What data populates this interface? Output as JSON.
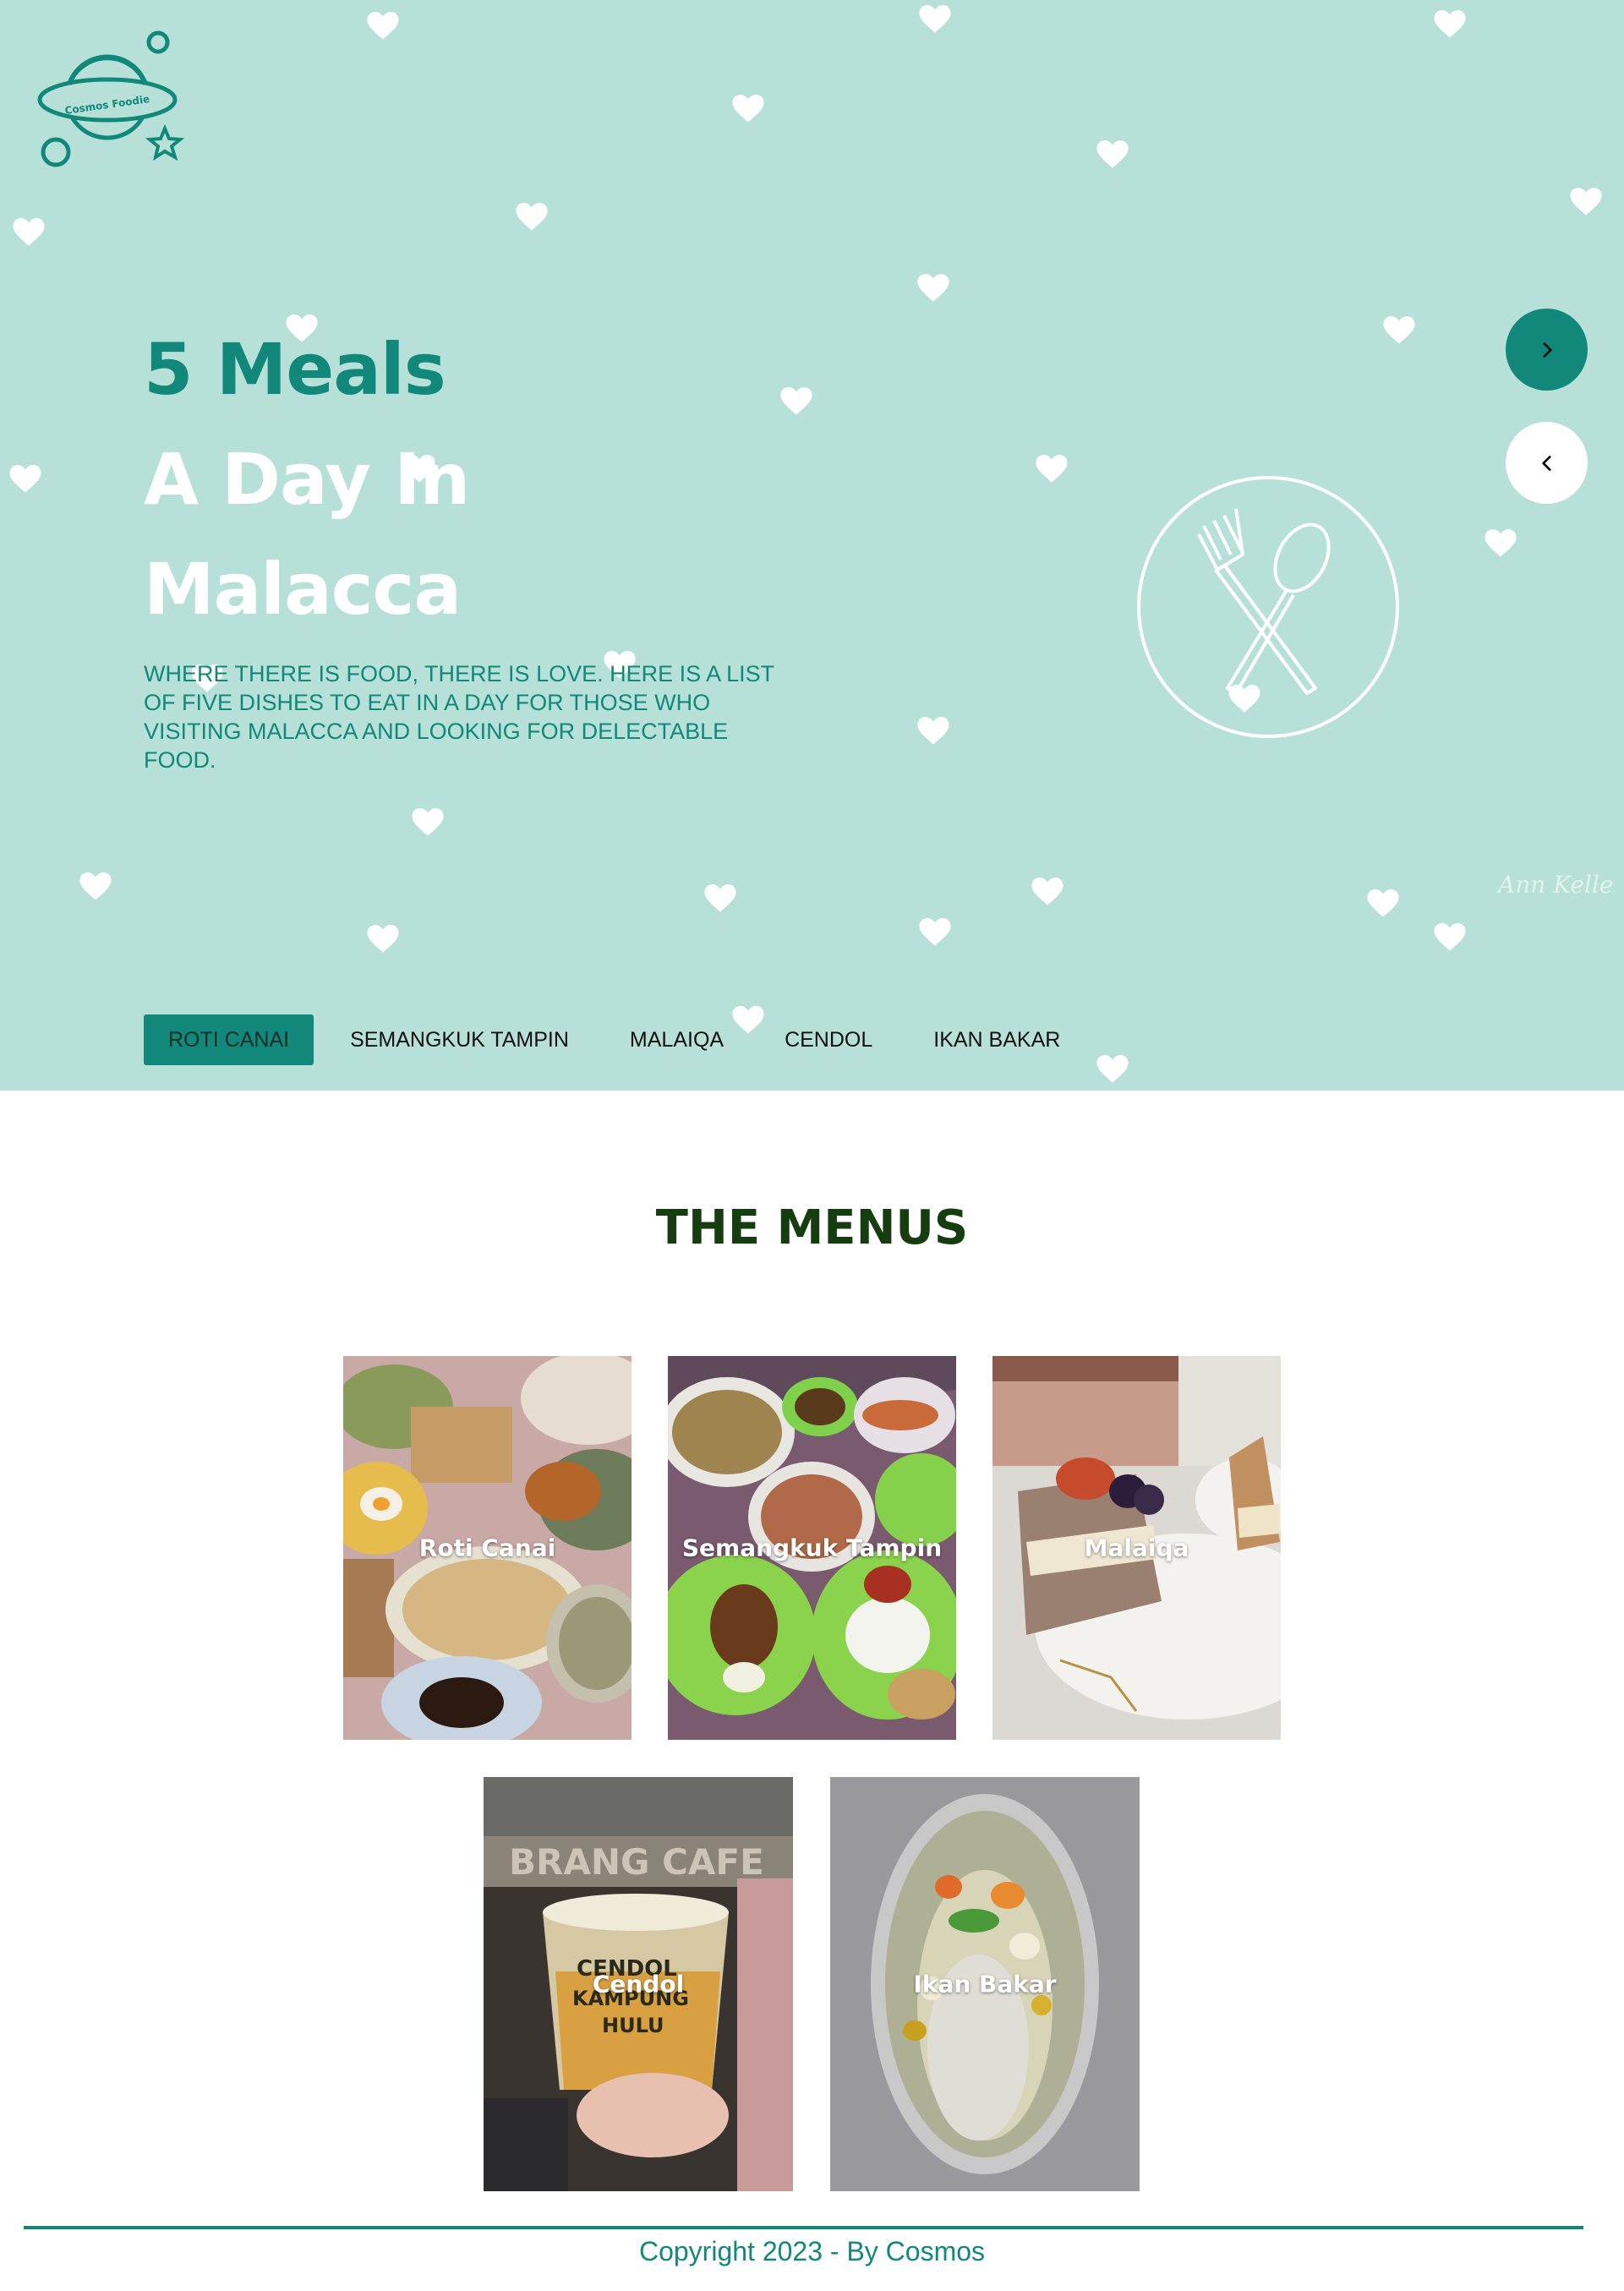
{
  "logo": {
    "text": "Cosmos Foodie"
  },
  "hero": {
    "title_line1": "5 Meals",
    "title_line2": "A Day In",
    "title_line3": "Malacca",
    "description": "WHERE THERE IS FOOD, THERE IS LOVE. HERE IS A LIST OF FIVE DISHES TO EAT IN A DAY FOR THOSE WHO VISITING MALACCA AND LOOKING FOR DELECTABLE FOOD.",
    "watermark": "Ann Kelle",
    "next_icon": "chevron-right-icon",
    "prev_icon": "chevron-left-icon",
    "illustration_icon": "fork-spoon-icon"
  },
  "tabs": [
    {
      "label": "ROTI CANAI",
      "active": true
    },
    {
      "label": "SEMANGKUK TAMPIN",
      "active": false
    },
    {
      "label": "MALAIQA",
      "active": false
    },
    {
      "label": "CENDOL",
      "active": false
    },
    {
      "label": "IKAN BAKAR",
      "active": false
    }
  ],
  "menus": {
    "title": "THE MENUS",
    "cards": [
      {
        "label": "Roti Canai"
      },
      {
        "label": "Semangkuk Tampin"
      },
      {
        "label": "Malaiqa"
      },
      {
        "label": "Cendol"
      },
      {
        "label": "Ikan Bakar"
      }
    ]
  },
  "colors": {
    "hero_bg": "#b6e0d8",
    "accent": "#11887a",
    "menus_title": "#153d0f"
  },
  "footer": {
    "copyright": "Copyright 2023 - By Cosmos"
  }
}
